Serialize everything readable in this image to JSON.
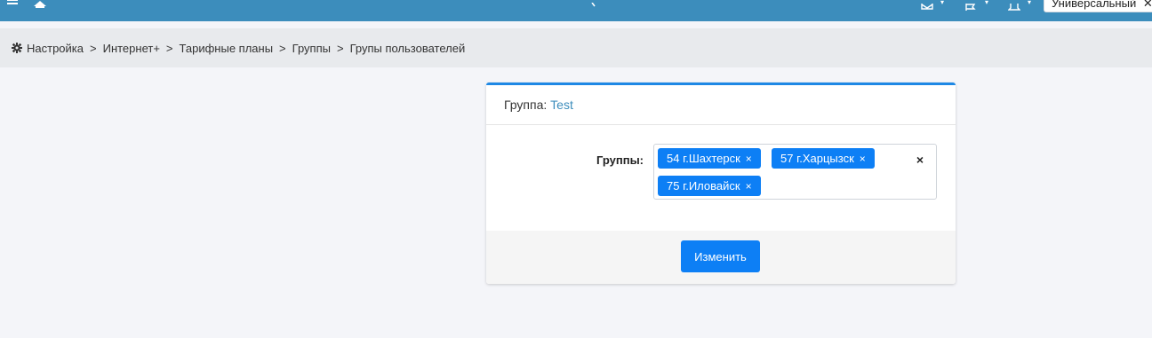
{
  "topbar": {
    "language_value": "Универсальный"
  },
  "breadcrumb": {
    "items": [
      "Настройка",
      "Интернет+",
      "Тарифные планы",
      "Группы",
      "Групы пользователей"
    ],
    "separator": ">"
  },
  "card": {
    "header_label": "Группа:",
    "group_name": "Test",
    "field_label": "Группы:",
    "selected_tags": [
      "54 г.Шахтерск",
      "57 г.Харцызск",
      "75 г.Иловайск"
    ],
    "tag_remove_glyph": "×",
    "clear_glyph": "×",
    "submit_label": "Изменить"
  },
  "colors": {
    "topbar": "#3c8dbc",
    "primary": "#0d7ff5",
    "card_accent": "#1e88e5",
    "link": "#3c8dbc"
  }
}
